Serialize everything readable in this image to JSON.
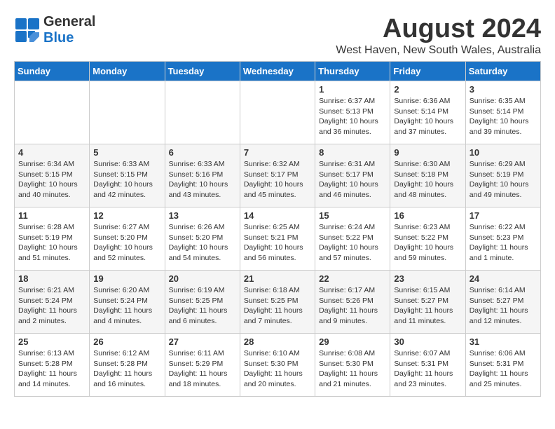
{
  "header": {
    "logo_general": "General",
    "logo_blue": "Blue",
    "month_title": "August 2024",
    "location": "West Haven, New South Wales, Australia"
  },
  "weekdays": [
    "Sunday",
    "Monday",
    "Tuesday",
    "Wednesday",
    "Thursday",
    "Friday",
    "Saturday"
  ],
  "weeks": [
    [
      {
        "day": "",
        "sunrise": "",
        "sunset": "",
        "daylight": ""
      },
      {
        "day": "",
        "sunrise": "",
        "sunset": "",
        "daylight": ""
      },
      {
        "day": "",
        "sunrise": "",
        "sunset": "",
        "daylight": ""
      },
      {
        "day": "",
        "sunrise": "",
        "sunset": "",
        "daylight": ""
      },
      {
        "day": "1",
        "sunrise": "Sunrise: 6:37 AM",
        "sunset": "Sunset: 5:13 PM",
        "daylight": "Daylight: 10 hours and 36 minutes."
      },
      {
        "day": "2",
        "sunrise": "Sunrise: 6:36 AM",
        "sunset": "Sunset: 5:14 PM",
        "daylight": "Daylight: 10 hours and 37 minutes."
      },
      {
        "day": "3",
        "sunrise": "Sunrise: 6:35 AM",
        "sunset": "Sunset: 5:14 PM",
        "daylight": "Daylight: 10 hours and 39 minutes."
      }
    ],
    [
      {
        "day": "4",
        "sunrise": "Sunrise: 6:34 AM",
        "sunset": "Sunset: 5:15 PM",
        "daylight": "Daylight: 10 hours and 40 minutes."
      },
      {
        "day": "5",
        "sunrise": "Sunrise: 6:33 AM",
        "sunset": "Sunset: 5:15 PM",
        "daylight": "Daylight: 10 hours and 42 minutes."
      },
      {
        "day": "6",
        "sunrise": "Sunrise: 6:33 AM",
        "sunset": "Sunset: 5:16 PM",
        "daylight": "Daylight: 10 hours and 43 minutes."
      },
      {
        "day": "7",
        "sunrise": "Sunrise: 6:32 AM",
        "sunset": "Sunset: 5:17 PM",
        "daylight": "Daylight: 10 hours and 45 minutes."
      },
      {
        "day": "8",
        "sunrise": "Sunrise: 6:31 AM",
        "sunset": "Sunset: 5:17 PM",
        "daylight": "Daylight: 10 hours and 46 minutes."
      },
      {
        "day": "9",
        "sunrise": "Sunrise: 6:30 AM",
        "sunset": "Sunset: 5:18 PM",
        "daylight": "Daylight: 10 hours and 48 minutes."
      },
      {
        "day": "10",
        "sunrise": "Sunrise: 6:29 AM",
        "sunset": "Sunset: 5:19 PM",
        "daylight": "Daylight: 10 hours and 49 minutes."
      }
    ],
    [
      {
        "day": "11",
        "sunrise": "Sunrise: 6:28 AM",
        "sunset": "Sunset: 5:19 PM",
        "daylight": "Daylight: 10 hours and 51 minutes."
      },
      {
        "day": "12",
        "sunrise": "Sunrise: 6:27 AM",
        "sunset": "Sunset: 5:20 PM",
        "daylight": "Daylight: 10 hours and 52 minutes."
      },
      {
        "day": "13",
        "sunrise": "Sunrise: 6:26 AM",
        "sunset": "Sunset: 5:20 PM",
        "daylight": "Daylight: 10 hours and 54 minutes."
      },
      {
        "day": "14",
        "sunrise": "Sunrise: 6:25 AM",
        "sunset": "Sunset: 5:21 PM",
        "daylight": "Daylight: 10 hours and 56 minutes."
      },
      {
        "day": "15",
        "sunrise": "Sunrise: 6:24 AM",
        "sunset": "Sunset: 5:22 PM",
        "daylight": "Daylight: 10 hours and 57 minutes."
      },
      {
        "day": "16",
        "sunrise": "Sunrise: 6:23 AM",
        "sunset": "Sunset: 5:22 PM",
        "daylight": "Daylight: 10 hours and 59 minutes."
      },
      {
        "day": "17",
        "sunrise": "Sunrise: 6:22 AM",
        "sunset": "Sunset: 5:23 PM",
        "daylight": "Daylight: 11 hours and 1 minute."
      }
    ],
    [
      {
        "day": "18",
        "sunrise": "Sunrise: 6:21 AM",
        "sunset": "Sunset: 5:24 PM",
        "daylight": "Daylight: 11 hours and 2 minutes."
      },
      {
        "day": "19",
        "sunrise": "Sunrise: 6:20 AM",
        "sunset": "Sunset: 5:24 PM",
        "daylight": "Daylight: 11 hours and 4 minutes."
      },
      {
        "day": "20",
        "sunrise": "Sunrise: 6:19 AM",
        "sunset": "Sunset: 5:25 PM",
        "daylight": "Daylight: 11 hours and 6 minutes."
      },
      {
        "day": "21",
        "sunrise": "Sunrise: 6:18 AM",
        "sunset": "Sunset: 5:25 PM",
        "daylight": "Daylight: 11 hours and 7 minutes."
      },
      {
        "day": "22",
        "sunrise": "Sunrise: 6:17 AM",
        "sunset": "Sunset: 5:26 PM",
        "daylight": "Daylight: 11 hours and 9 minutes."
      },
      {
        "day": "23",
        "sunrise": "Sunrise: 6:15 AM",
        "sunset": "Sunset: 5:27 PM",
        "daylight": "Daylight: 11 hours and 11 minutes."
      },
      {
        "day": "24",
        "sunrise": "Sunrise: 6:14 AM",
        "sunset": "Sunset: 5:27 PM",
        "daylight": "Daylight: 11 hours and 12 minutes."
      }
    ],
    [
      {
        "day": "25",
        "sunrise": "Sunrise: 6:13 AM",
        "sunset": "Sunset: 5:28 PM",
        "daylight": "Daylight: 11 hours and 14 minutes."
      },
      {
        "day": "26",
        "sunrise": "Sunrise: 6:12 AM",
        "sunset": "Sunset: 5:28 PM",
        "daylight": "Daylight: 11 hours and 16 minutes."
      },
      {
        "day": "27",
        "sunrise": "Sunrise: 6:11 AM",
        "sunset": "Sunset: 5:29 PM",
        "daylight": "Daylight: 11 hours and 18 minutes."
      },
      {
        "day": "28",
        "sunrise": "Sunrise: 6:10 AM",
        "sunset": "Sunset: 5:30 PM",
        "daylight": "Daylight: 11 hours and 20 minutes."
      },
      {
        "day": "29",
        "sunrise": "Sunrise: 6:08 AM",
        "sunset": "Sunset: 5:30 PM",
        "daylight": "Daylight: 11 hours and 21 minutes."
      },
      {
        "day": "30",
        "sunrise": "Sunrise: 6:07 AM",
        "sunset": "Sunset: 5:31 PM",
        "daylight": "Daylight: 11 hours and 23 minutes."
      },
      {
        "day": "31",
        "sunrise": "Sunrise: 6:06 AM",
        "sunset": "Sunset: 5:31 PM",
        "daylight": "Daylight: 11 hours and 25 minutes."
      }
    ]
  ]
}
